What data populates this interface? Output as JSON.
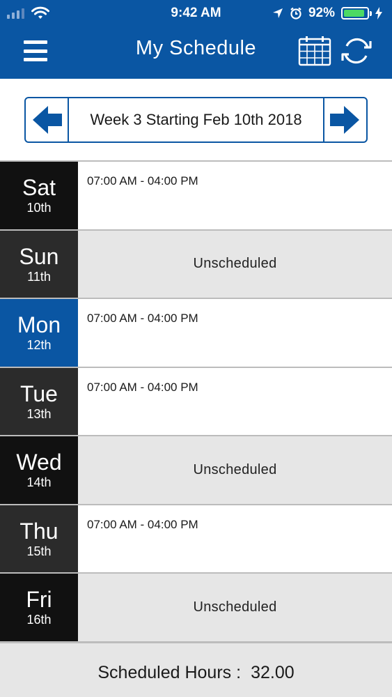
{
  "status_bar": {
    "time": "9:42 AM",
    "battery": "92%",
    "battery_level": 0.92
  },
  "header": {
    "title": "My Schedule",
    "icons": [
      "hamburger-menu-icon",
      "calendar-icon",
      "refresh-icon"
    ]
  },
  "week_nav": {
    "label": "Week 3 Starting Feb 10th 2018"
  },
  "days": [
    {
      "name": "Sat",
      "date": "10th",
      "shift": "07:00 AM - 04:00 PM",
      "status": ""
    },
    {
      "name": "Sun",
      "date": "11th",
      "shift": "",
      "status": "Unscheduled"
    },
    {
      "name": "Mon",
      "date": "12th",
      "shift": "07:00 AM - 04:00 PM",
      "status": ""
    },
    {
      "name": "Tue",
      "date": "13th",
      "shift": "07:00 AM - 04:00 PM",
      "status": ""
    },
    {
      "name": "Wed",
      "date": "14th",
      "shift": "",
      "status": "Unscheduled"
    },
    {
      "name": "Thu",
      "date": "15th",
      "shift": "07:00 AM - 04:00 PM",
      "status": ""
    },
    {
      "name": "Fri",
      "date": "16th",
      "shift": "",
      "status": "Unscheduled"
    }
  ],
  "footer": {
    "label": "Scheduled Hours :",
    "value": "32.00"
  },
  "colors": {
    "primary": "#0a56a3",
    "battery": "#4cd964",
    "unscheduled_bg": "#e6e6e6"
  }
}
